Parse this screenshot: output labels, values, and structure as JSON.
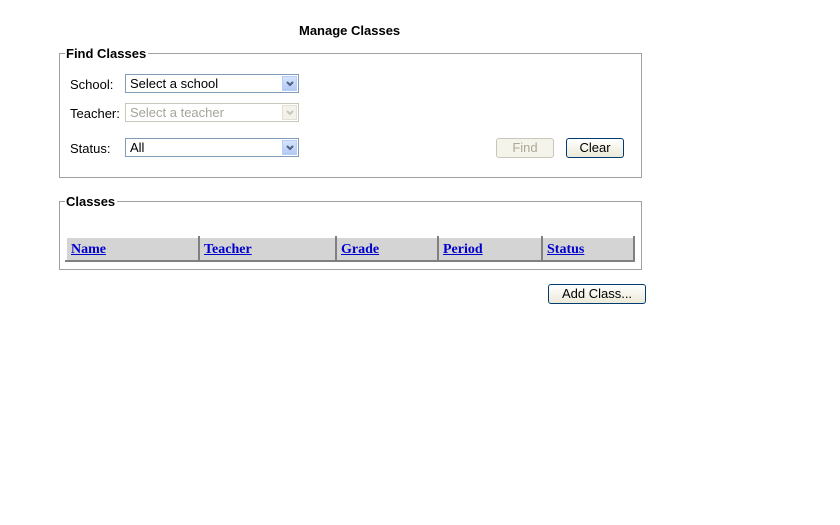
{
  "page": {
    "title": "Manage Classes"
  },
  "find_classes": {
    "legend": "Find Classes",
    "fields": [
      {
        "label": "School:",
        "value": "Select a school",
        "disabled": false
      },
      {
        "label": "Teacher:",
        "value": "Select a teacher",
        "disabled": true
      },
      {
        "label": "Status:",
        "value": "All",
        "disabled": false
      }
    ],
    "find_button": "Find",
    "find_disabled": true,
    "clear_button": "Clear"
  },
  "classes": {
    "legend": "Classes",
    "columns": [
      "Name",
      "Teacher",
      "Grade",
      "Period",
      "Status"
    ],
    "rows": []
  },
  "add_class_button": "Add Class...",
  "icons": {
    "dropdown": "chevron-down-icon"
  },
  "colors": {
    "link": "#0000cc",
    "header_bg": "#d4d4d4",
    "select_border": "#7f9db9"
  }
}
